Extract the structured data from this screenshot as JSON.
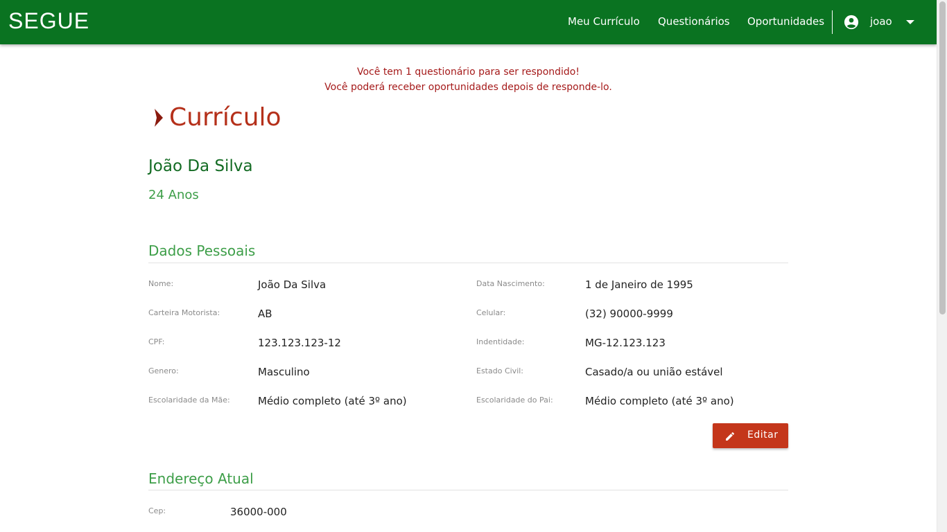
{
  "header": {
    "brand": "SEGUE",
    "nav": [
      "Meu Currículo",
      "Questionários",
      "Oportunidades"
    ],
    "user": "joao",
    "color": "#0a7321"
  },
  "notice": {
    "line1": "Você tem 1 questionário para ser respondido!",
    "line2": "Você poderá receber oportunidades depois de responde-lo."
  },
  "page": {
    "title": "Currículo",
    "person_name": "João Da Silva",
    "age": "24 Anos"
  },
  "dados_pessoais": {
    "title": "Dados Pessoais",
    "fields": [
      {
        "label": "Nome:",
        "value": "João Da Silva"
      },
      {
        "label": "Data Nascimento:",
        "value": "1 de Janeiro de 1995"
      },
      {
        "label": "Carteira Motorista:",
        "value": "AB"
      },
      {
        "label": "Celular:",
        "value": "(32) 90000-9999"
      },
      {
        "label": "CPF:",
        "value": "123.123.123-12"
      },
      {
        "label": "Indentidade:",
        "value": "MG-12.123.123"
      },
      {
        "label": "Genero:",
        "value": "Masculino"
      },
      {
        "label": "Estado Civil:",
        "value": "Casado/a ou união estável"
      },
      {
        "label": "Escolaridade da Mãe:",
        "value": "Médio completo (até 3º ano)"
      },
      {
        "label": "Escolaridade do Pai:",
        "value": "Médio completo (até 3º ano)"
      }
    ],
    "edit_label": "Editar"
  },
  "endereco": {
    "title": "Endereço Atual",
    "fields": [
      {
        "label": "Cep:",
        "value": "36000-000"
      }
    ]
  },
  "colors": {
    "title": "#b5301a",
    "section": "#3d9e48",
    "name": "#136b23",
    "notice": "#a51a1a",
    "button": "#c4361a"
  },
  "icons": {
    "account": "account-circle-icon",
    "caret": "caret-down-icon",
    "chevron": "chevron-right-icon",
    "edit": "pencil-icon"
  }
}
